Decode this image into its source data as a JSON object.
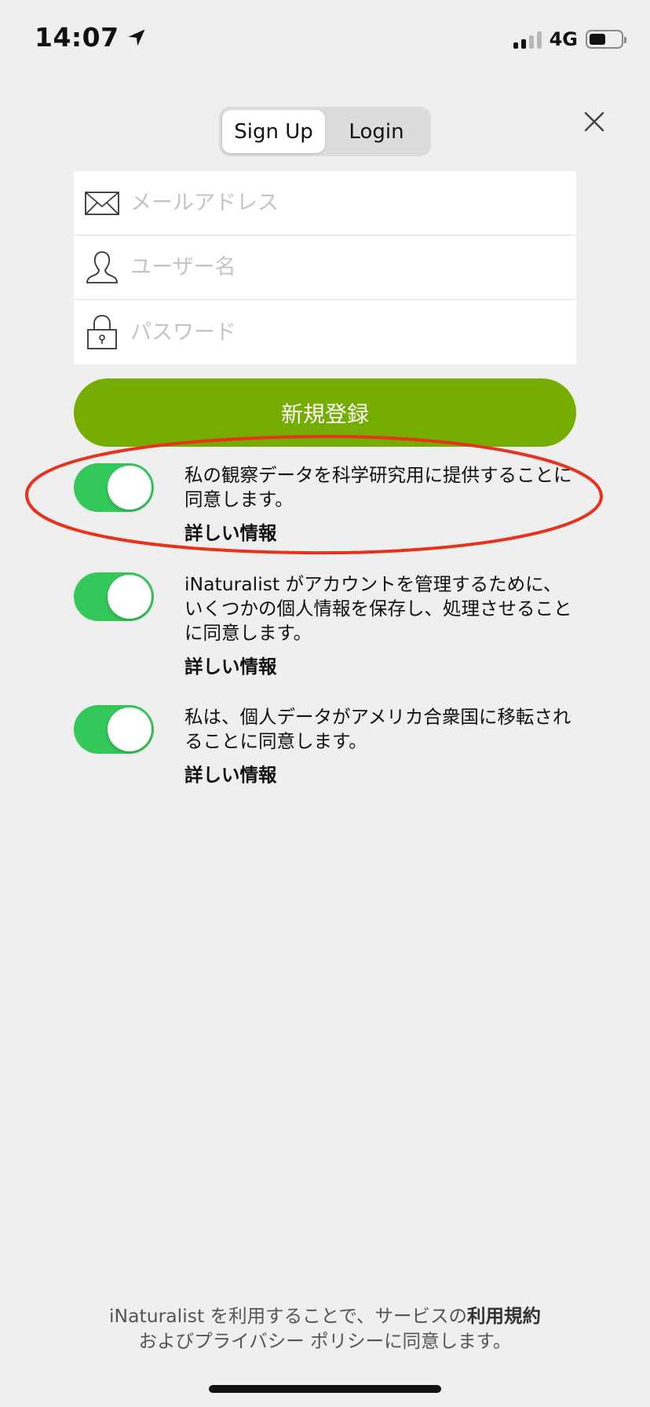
{
  "status_bar": {
    "time": "14:07",
    "network": "4G"
  },
  "tabs": {
    "signup": "Sign Up",
    "login": "Login",
    "active": "signup"
  },
  "form": {
    "email_placeholder": "メールアドレス",
    "username_placeholder": "ユーザー名",
    "password_placeholder": "パスワード",
    "submit_label": "新規登録"
  },
  "consents": [
    {
      "text": "私の観察データを科学研究用に提供することに同意します。",
      "more": "詳しい情報",
      "enabled": true
    },
    {
      "text": "iNaturalist がアカウントを管理するために、いくつかの個人情報を保存し、処理させることに同意します。",
      "more": "詳しい情報",
      "enabled": true
    },
    {
      "text": "私は、個人データがアメリカ合衆国に移転されることに同意します。",
      "more": "詳しい情報",
      "enabled": true
    }
  ],
  "footer": {
    "prefix": "iNaturalist を利用することで、サービスの",
    "terms": "利用規約",
    "middle": "および",
    "privacy": "プライバシー ポリシー",
    "suffix": "に同意します。"
  },
  "colors": {
    "accent": "#74ac00",
    "toggle_on": "#34c759",
    "annotation": "#e8321e"
  }
}
